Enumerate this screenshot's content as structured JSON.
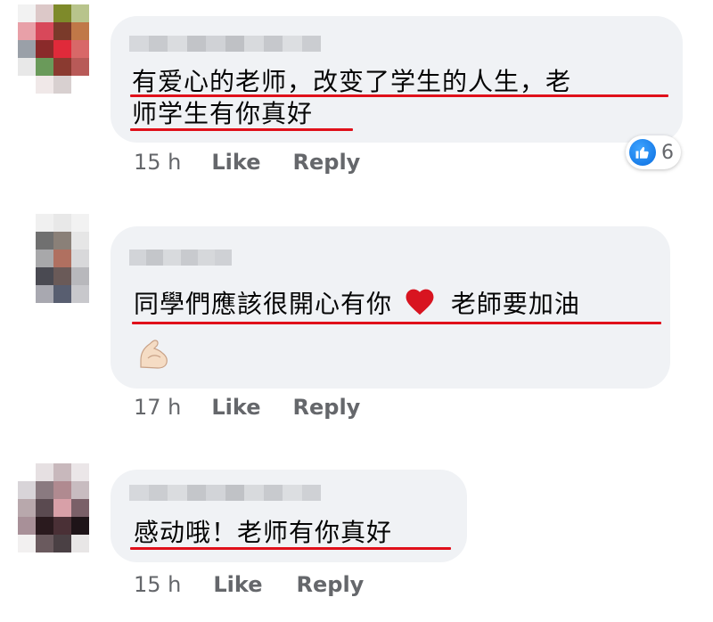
{
  "comments": [
    {
      "lines": [
        "有爱心的老师，改变了学生的人生，老",
        "师学生有你真好"
      ],
      "time": "15 h",
      "like": "Like",
      "reply": "Reply",
      "reaction_count": "6",
      "reaction_icon": "thumbs-up-icon"
    },
    {
      "lines": [
        "同學們應該很開心有你",
        "老師要加油"
      ],
      "emoji_heart": "❤️",
      "emoji_flex": "💪",
      "time": "17 h",
      "like": "Like",
      "reply": "Reply"
    },
    {
      "lines": [
        "感动哦！老师有你真好"
      ],
      "time": "15 h",
      "like": "Like",
      "reply": "Reply"
    }
  ],
  "colors": {
    "bubble": "#f0f2f5",
    "underline": "#e0101a",
    "meta_text": "#65676b",
    "like_blue": "#1877f2"
  }
}
